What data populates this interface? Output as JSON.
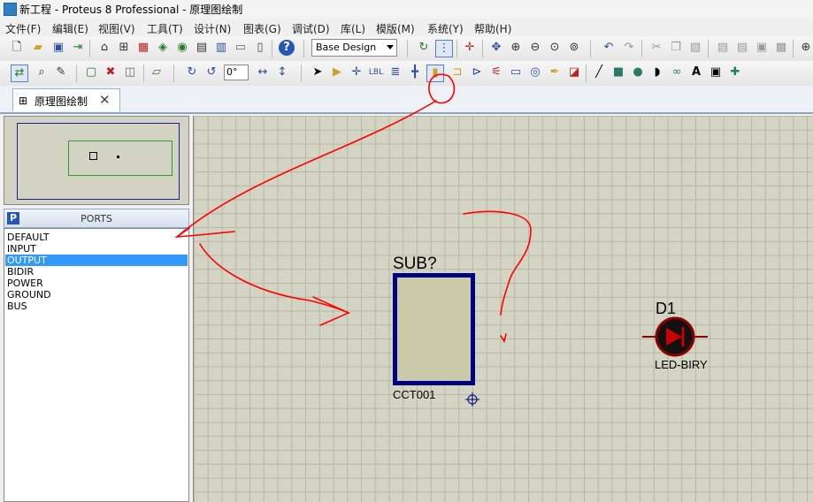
{
  "window": {
    "title": "新工程 - Proteus 8 Professional - 原理图绘制"
  },
  "menu": [
    {
      "label": "文件(F)"
    },
    {
      "label": "编辑(E)"
    },
    {
      "label": "视图(V)"
    },
    {
      "label": "工具(T)"
    },
    {
      "label": "设计(N)"
    },
    {
      "label": "图表(G)"
    },
    {
      "label": "调试(D)"
    },
    {
      "label": "库(L)"
    },
    {
      "label": "模版(M)"
    },
    {
      "label": "系统(Y)"
    },
    {
      "label": "帮助(H)"
    }
  ],
  "toolbar": {
    "design_select": "Base Design",
    "rotation_angle": "0°"
  },
  "tab": {
    "label": "原理图绘制",
    "close": "✕"
  },
  "ports_panel": {
    "badge": "P",
    "title": "PORTS",
    "items": [
      "DEFAULT",
      "INPUT",
      "OUTPUT",
      "BIDIR",
      "POWER",
      "GROUND",
      "BUS"
    ],
    "selected": "OUTPUT"
  },
  "schematic": {
    "subcircuit": {
      "ref": "SUB?",
      "name": "CCT001"
    },
    "diode": {
      "ref": "D1",
      "part": "LED-BIRY"
    }
  },
  "colors": {
    "canvas": "#d4d4c4",
    "wire": "#000080",
    "annotation": "#ff0000",
    "selection": "#3399ff"
  }
}
